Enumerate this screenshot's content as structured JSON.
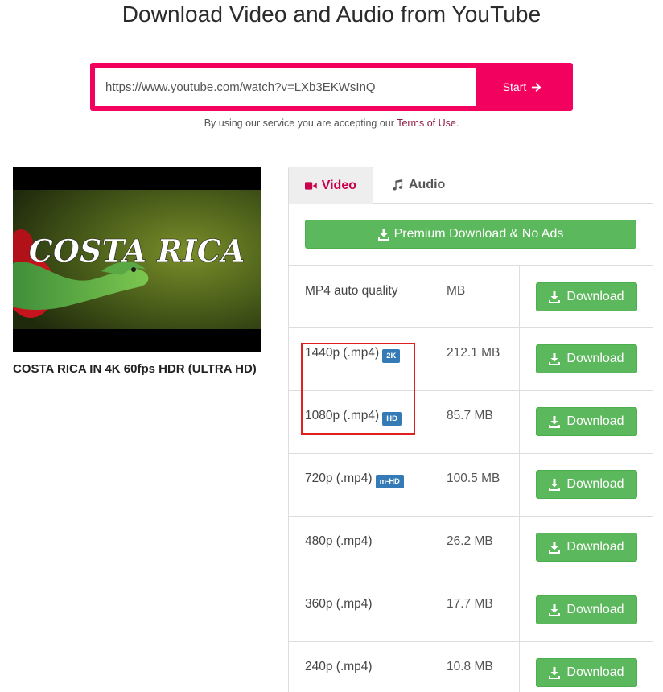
{
  "header": {
    "title": "Download Video and Audio from YouTube"
  },
  "search": {
    "value": "https://www.youtube.com/watch?v=LXb3EKWsInQ",
    "start_label": "Start",
    "start_icon": "arrow-right-icon"
  },
  "terms": {
    "prefix": "By using our service you are accepting our",
    "link": "Terms of Use",
    "suffix": "."
  },
  "video": {
    "thumbnail_text": "COSTA RICA",
    "title": "COSTA RICA IN 4K 60fps HDR (ULTRA HD)"
  },
  "tabs": [
    {
      "label": "Video",
      "icon": "video-camera-icon",
      "active": true
    },
    {
      "label": "Audio",
      "icon": "music-note-icon",
      "active": false
    }
  ],
  "premium": {
    "label": "Premium Download & No Ads",
    "icon": "download-icon"
  },
  "formats": [
    {
      "quality": "MP4 auto quality",
      "badge": "",
      "size": "MB",
      "button": "Download"
    },
    {
      "quality": "1440p (.mp4)",
      "badge": "2K",
      "size": "212.1 MB",
      "button": "Download"
    },
    {
      "quality": "1080p (.mp4)",
      "badge": "HD",
      "size": "85.7 MB",
      "button": "Download"
    },
    {
      "quality": "720p (.mp4)",
      "badge": "m-HD",
      "size": "100.5 MB",
      "button": "Download"
    },
    {
      "quality": "480p (.mp4)",
      "badge": "",
      "size": "26.2 MB",
      "button": "Download"
    },
    {
      "quality": "360p (.mp4)",
      "badge": "",
      "size": "17.7 MB",
      "button": "Download"
    },
    {
      "quality": "240p (.mp4)",
      "badge": "",
      "size": "10.8 MB",
      "button": "Download"
    }
  ],
  "colors": {
    "accent": "#f2015f",
    "download_green": "#5cb85c",
    "badge_blue": "#337ab7",
    "tab_active_text": "#c9004c",
    "highlight_red": "#e02020"
  }
}
